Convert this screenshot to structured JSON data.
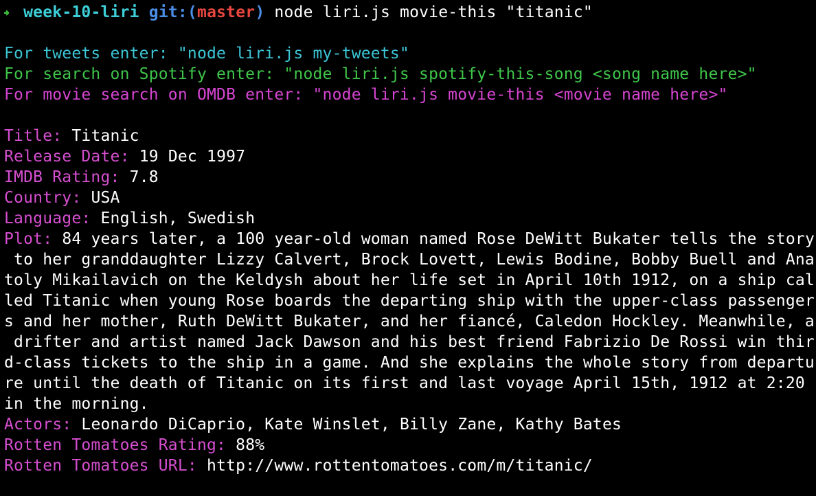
{
  "prompt": {
    "arrow": "→",
    "directory": "week-10-liri",
    "git_prefix": "git:(",
    "branch": "master",
    "git_suffix": ")",
    "command": " node liri.js movie-this \"titanic\""
  },
  "instructions": {
    "tweets": "For tweets enter: \"node liri.js my-tweets\"",
    "spotify": "For search on Spotify enter: \"node liri.js spotify-this-song <song name here>\"",
    "movie": "For movie search on OMDB enter: \"node liri.js movie-this <movie name here>\""
  },
  "movie": {
    "title_label": "Title:",
    "title": "Titanic",
    "release_label": "Release Date:",
    "release": "19 Dec 1997",
    "imdb_label": "IMDB Rating:",
    "imdb": "7.8",
    "country_label": "Country:",
    "country": "USA",
    "language_label": "Language:",
    "language": "English, Swedish",
    "plot_label": "Plot:",
    "plot_lines": [
      "84 years later, a 100 year-old woman named Rose DeWitt Bukater tells the story",
      " to her granddaughter Lizzy Calvert, Brock Lovett, Lewis Bodine, Bobby Buell and Ana",
      "toly Mikailavich on the Keldysh about her life set in April 10th 1912, on a ship cal",
      "led Titanic when young Rose boards the departing ship with the upper-class passenger",
      "s and her mother, Ruth DeWitt Bukater, and her fiancé, Caledon Hockley. Meanwhile, a",
      " drifter and artist named Jack Dawson and his best friend Fabrizio De Rossi win thir",
      "d-class tickets to the ship in a game. And she explains the whole story from departu",
      "re until the death of Titanic on its first and last voyage April 15th, 1912 at 2:20",
      "in the morning."
    ],
    "actors_label": "Actors:",
    "actors": "Leonardo DiCaprio, Kate Winslet, Billy Zane, Kathy Bates",
    "rt_rating_label": "Rotten Tomatoes Rating:",
    "rt_rating": "88%",
    "rt_url_label": "Rotten Tomatoes URL:",
    "rt_url": "http://www.rottentomatoes.com/m/titanic/"
  },
  "colors": {
    "background": "#000000",
    "label": "#d64fd0",
    "cyan": "#3cc6d6",
    "green": "#3fc64a",
    "magenta": "#d746d3",
    "branch": "#e8473f",
    "git": "#4b8ee8"
  }
}
